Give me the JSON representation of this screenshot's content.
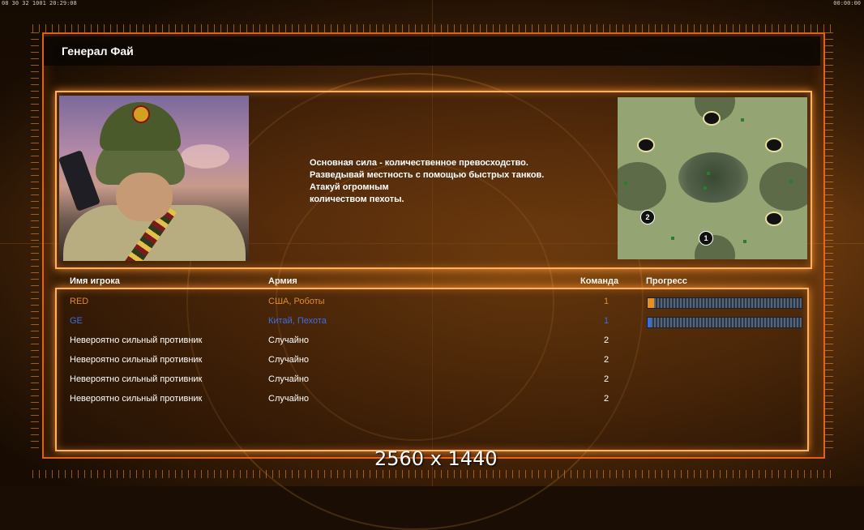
{
  "hud": {
    "clock_left": "08 30 32 1001  20:29:08",
    "clock_right": "00:00:00"
  },
  "general": {
    "title": "Генерал Фай"
  },
  "briefing": {
    "lines": [
      "Основная сила - количественное превосходство.",
      "Разведывай местность с помощью быстрых танков.",
      "Атакуй огромным",
      "количеством пехоты."
    ]
  },
  "minimap": {
    "start_markers": [
      "2",
      "1"
    ]
  },
  "table": {
    "headers": {
      "name": "Имя игрока",
      "army": "Армия",
      "team": "Команда",
      "progress": "Прогресс"
    },
    "rows": [
      {
        "name": "RED",
        "army": "США, Роботы",
        "team": "1",
        "color": "#e08a2a",
        "progress": 0.04
      },
      {
        "name": "GE",
        "army": "Китай, Пехота",
        "team": "1",
        "color": "#3a6ee8",
        "progress": 0.02
      },
      {
        "name": "Невероятно сильный противник",
        "army": "Случайно",
        "team": "2",
        "color": "#ffffff",
        "progress": null
      },
      {
        "name": "Невероятно сильный противник",
        "army": "Случайно",
        "team": "2",
        "color": "#ffffff",
        "progress": null
      },
      {
        "name": "Невероятно сильный противник",
        "army": "Случайно",
        "team": "2",
        "color": "#ffffff",
        "progress": null
      },
      {
        "name": "Невероятно сильный противник",
        "army": "Случайно",
        "team": "2",
        "color": "#ffffff",
        "progress": null
      }
    ]
  },
  "resolution_label": "2560 x 1440",
  "colors": {
    "frame_glow": "#ffb060",
    "frame_outer": "#ff6e1e",
    "progress_orange": "#e8901e",
    "progress_blue": "#3a6ee8"
  }
}
